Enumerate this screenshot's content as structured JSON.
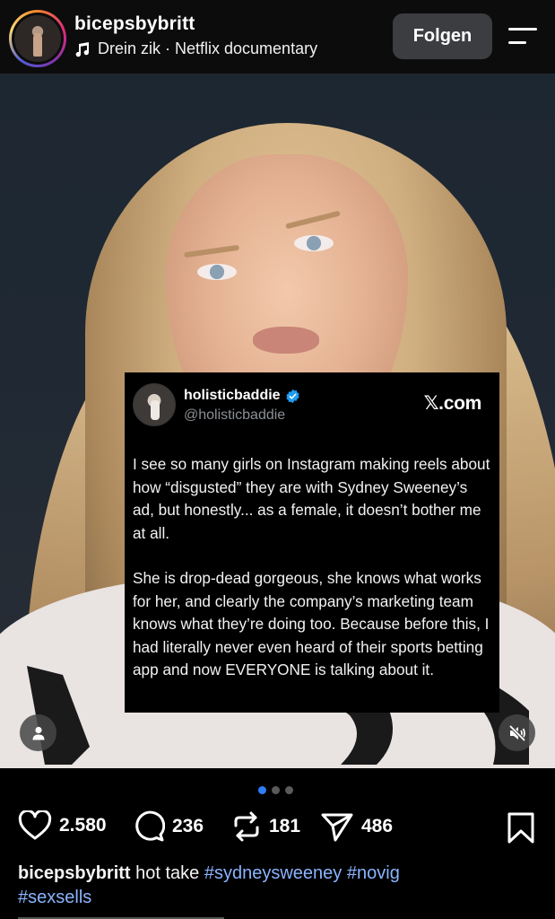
{
  "header": {
    "username": "bicepsbybritt",
    "audio": "Drein zik · Netflix documentary",
    "follow_label": "Folgen",
    "menu_icon": "menu-icon"
  },
  "media": {
    "tweet": {
      "display_name": "holisticbaddie",
      "handle": "@holisticbaddie",
      "source": "𝕏.com",
      "verified_color": "#1d9bf0",
      "paragraph_1": "I see so many girls on Instagram making reels about how “disgusted” they are with Sydney Sweeney’s ad, but honestly... as a female, it doesn’t bother me at all.",
      "paragraph_2": "She is drop-dead gorgeous, she knows what works for her, and clearly the company’s marketing team knows what they’re doing too. Because before this, I had literally never even heard of their sports betting app and now EVERYONE is talking about it."
    },
    "carousel": {
      "current": 1,
      "total": 3
    },
    "overlay_icons": [
      "person-icon",
      "muted-speaker-icon"
    ]
  },
  "actions": {
    "likes": "2.580",
    "comments": "236",
    "reposts": "181",
    "shares": "486"
  },
  "caption": {
    "username": "bicepsbybritt",
    "text": "hot take",
    "tags": [
      "#sydneysweeney",
      "#novig",
      "#sexsells"
    ]
  },
  "colors": {
    "accent": "#2f7df6",
    "hashtag": "#8ab4ff",
    "follow_bg": "#3b3d40"
  }
}
